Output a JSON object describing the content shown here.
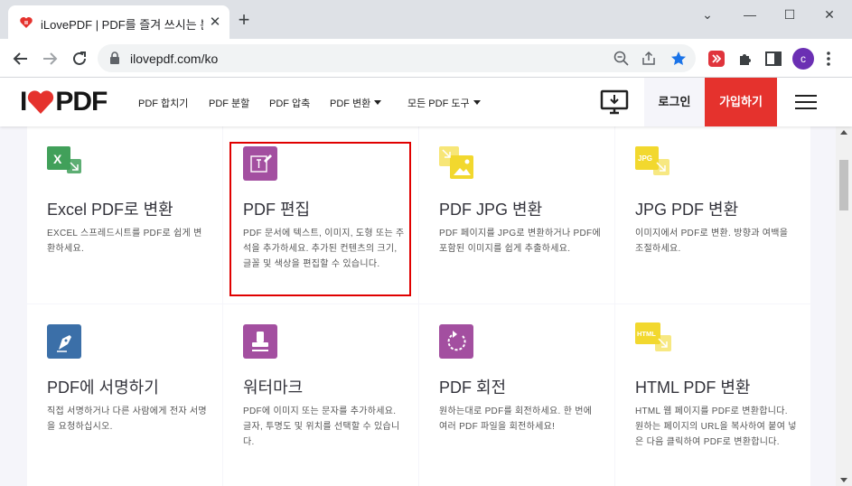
{
  "browser": {
    "tab_title": "iLovePDF | PDF를 즐겨 쓰시는 분",
    "url": "ilovepdf.com/ko",
    "profile_initial": "c"
  },
  "header": {
    "nav": [
      {
        "label": "PDF 합치기"
      },
      {
        "label": "PDF 분할"
      },
      {
        "label": "PDF 압축"
      },
      {
        "label": "PDF 변환"
      },
      {
        "label": "모든 PDF 도구"
      }
    ],
    "login": "로그인",
    "signup": "가입하기"
  },
  "cards": [
    {
      "title": "Excel PDF로 변환",
      "desc": "EXCEL 스프레드시트를 PDF로 쉽게 변환하세요.",
      "icon": "excel-to-pdf-icon",
      "color": "#41a05a"
    },
    {
      "title": "PDF 편집",
      "desc": "PDF 문서에 텍스트, 이미지, 도형 또는 주석을 추가하세요. 추가된 컨텐츠의 크기, 글꼴 및 색상을 편집할 수 있습니다.",
      "icon": "edit-pdf-icon",
      "color": "#a34fa0"
    },
    {
      "title": "PDF JPG 변환",
      "desc": "PDF 페이지를 JPG로 변환하거나 PDF에 포함된 이미지를 쉽게 추출하세요.",
      "icon": "pdf-to-jpg-icon",
      "color": "#f2d82e"
    },
    {
      "title": "JPG PDF 변환",
      "desc": "이미지에서 PDF로 변환. 방향과 여백을 조절하세요.",
      "icon": "jpg-to-pdf-icon",
      "color": "#f2d82e"
    },
    {
      "title": "PDF에 서명하기",
      "desc": "직접 서명하거나 다른 사람에게 전자 서명을 요청하십시오.",
      "icon": "sign-pdf-icon",
      "color": "#3b6fa8"
    },
    {
      "title": "워터마크",
      "desc": "PDF에 이미지 또는 문자를 추가하세요. 글자, 투명도 및 위치를 선택할 수 있습니다.",
      "icon": "watermark-icon",
      "color": "#a34fa0"
    },
    {
      "title": "PDF 회전",
      "desc": "원하는대로 PDF를 회전하세요. 한 번에 여러 PDF 파일을 회전하세요!",
      "icon": "rotate-pdf-icon",
      "color": "#a34fa0"
    },
    {
      "title": "HTML PDF 변환",
      "desc": "HTML 웹 페이지를 PDF로 변환합니다. 원하는 페이지의 URL을 복사하여 붙여 넣은 다음 클릭하여 PDF로 변환합니다.",
      "icon": "html-to-pdf-icon",
      "color": "#f2d82e"
    }
  ],
  "icon_labels": {
    "excel": "X",
    "jpg": "JPG",
    "html": "HTML"
  },
  "colors": {
    "brand_red": "#e5322d",
    "highlight": "#e00000"
  }
}
